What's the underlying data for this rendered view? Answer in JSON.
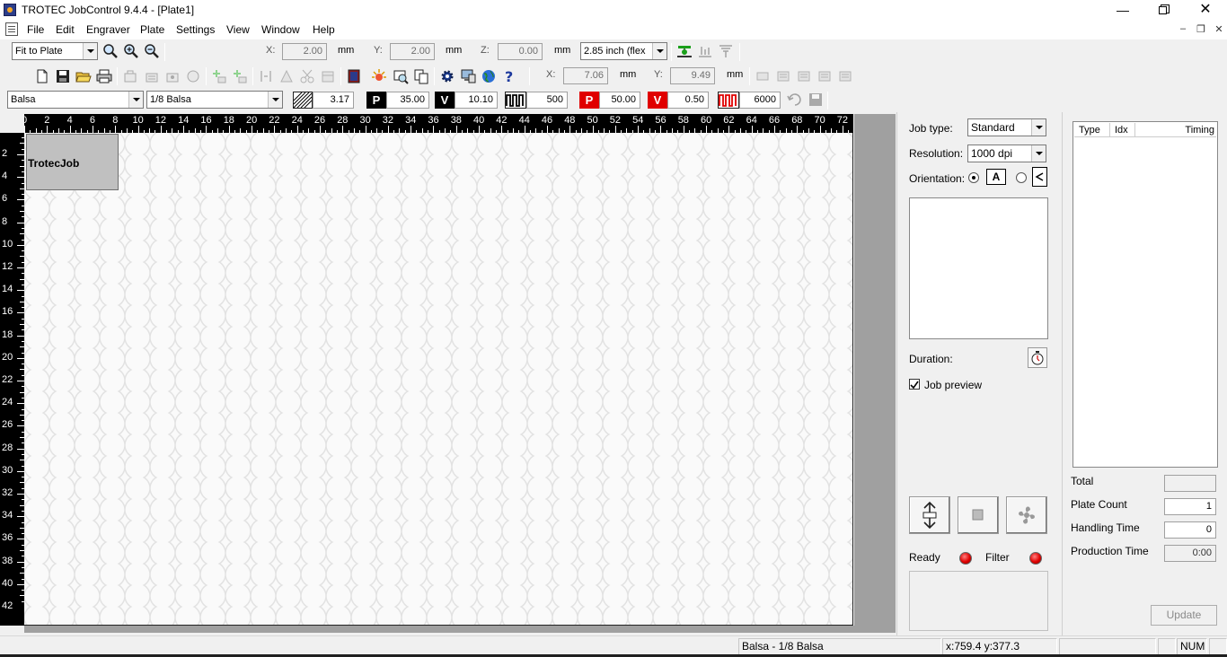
{
  "title": "TROTEC JobControl 9.4.4 - [Plate1]",
  "menu": [
    "File",
    "Edit",
    "Engraver",
    "Plate",
    "Settings",
    "View",
    "Window",
    "Help"
  ],
  "toolbar1": {
    "zoom_select": "Fit to Plate",
    "x_label": "X:",
    "x_value": "2.00",
    "x_unit": "mm",
    "y_label": "Y:",
    "y_value": "2.00",
    "y_unit": "mm",
    "z_label": "Z:",
    "z_value": "0.00",
    "z_unit": "mm",
    "lens_select": "2.85 inch (flex"
  },
  "toolbar2": {
    "x_label": "X:",
    "x_value": "7.06",
    "x_unit": "mm",
    "y_label": "Y:",
    "y_value": "9.49",
    "y_unit": "mm"
  },
  "toolbar3": {
    "material": "Balsa",
    "thickness": "1/8 Balsa",
    "depth": "3.17",
    "engrave_power": "35.00",
    "engrave_velocity": "10.10",
    "engrave_ppi": "500",
    "cut_power": "50.00",
    "cut_velocity": "0.50",
    "cut_freq": "6000",
    "p_letter": "P",
    "v_letter": "V"
  },
  "ruler": {
    "h_ticks": [
      "0",
      "2",
      "4",
      "6",
      "8",
      "10",
      "12",
      "14",
      "16",
      "18",
      "20",
      "22",
      "24",
      "26",
      "28",
      "30",
      "32",
      "34",
      "36",
      "38",
      "40",
      "42",
      "44",
      "46",
      "48",
      "50",
      "52",
      "54",
      "56",
      "58",
      "60",
      "62",
      "64",
      "66",
      "68",
      "70",
      "72"
    ],
    "v_ticks": [
      "2",
      "4",
      "6",
      "8",
      "10",
      "12",
      "14",
      "16",
      "18",
      "20",
      "22",
      "24",
      "26",
      "28",
      "30",
      "32",
      "34",
      "36",
      "38",
      "40",
      "42"
    ]
  },
  "job": {
    "label": "TrotecJob"
  },
  "panel1": {
    "job_type_label": "Job type:",
    "job_type_value": "Standard",
    "resolution_label": "Resolution:",
    "resolution_value": "1000 dpi",
    "orientation_label": "Orientation:",
    "orientation_glyph": "A",
    "duration_label": "Duration:",
    "job_preview_label": "Job preview",
    "ready_label": "Ready",
    "filter_label": "Filter"
  },
  "panel2": {
    "columns": [
      "Type",
      "Idx",
      "Timing"
    ],
    "total_label": "Total",
    "total_value": "",
    "plate_count_label": "Plate Count",
    "plate_count_value": "1",
    "handling_time_label": "Handling Time",
    "handling_time_value": "0",
    "production_time_label": "Production Time",
    "production_time_value": "0:00",
    "update_label": "Update"
  },
  "status": {
    "material": "Balsa - 1/8 Balsa",
    "coords": "x:759.4  y:377.3",
    "num": "NUM"
  }
}
